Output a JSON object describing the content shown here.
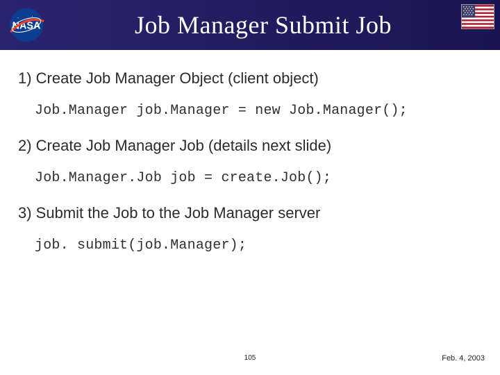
{
  "header": {
    "title": "Job Manager Submit Job"
  },
  "steps": {
    "s1": "1) Create Job Manager Object (client object)",
    "c1": "Job.Manager job.Manager = new Job.Manager();",
    "s2": "2) Create Job Manager Job (details next slide)",
    "c2": "Job.Manager.Job job = create.Job();",
    "s3": "3) Submit the Job to the Job Manager server",
    "c3": "job. submit(job.Manager);"
  },
  "footer": {
    "page": "105",
    "date": "Feb. 4, 2003"
  }
}
